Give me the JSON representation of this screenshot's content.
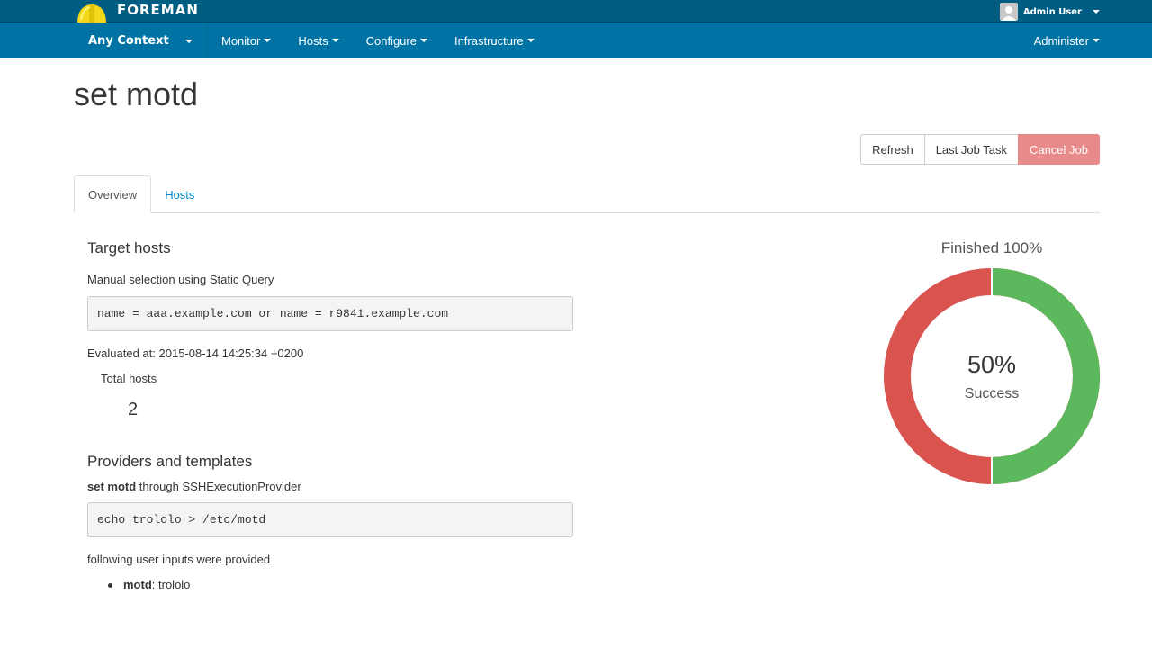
{
  "app": {
    "brand": "FOREMAN",
    "user": "Admin User"
  },
  "nav": {
    "context": "Any Context",
    "items": [
      {
        "label": "Monitor"
      },
      {
        "label": "Hosts"
      },
      {
        "label": "Configure"
      },
      {
        "label": "Infrastructure"
      }
    ],
    "right": "Administer"
  },
  "page": {
    "title": "set motd"
  },
  "actions": {
    "refresh": "Refresh",
    "last_job_task": "Last Job Task",
    "cancel_job": "Cancel Job"
  },
  "tabs": [
    {
      "label": "Overview",
      "active": true
    },
    {
      "label": "Hosts",
      "active": false
    }
  ],
  "target_hosts": {
    "heading": "Target hosts",
    "selection": "Manual selection using Static Query",
    "query": "name = aaa.example.com or name = r9841.example.com",
    "evaluated_at": "Evaluated at: 2015-08-14 14:25:34 +0200",
    "total_label": "Total hosts",
    "total_value": "2"
  },
  "providers": {
    "heading": "Providers and templates",
    "template_name": "set motd",
    "through_text": " through SSHExecutionProvider",
    "command": "echo trololo > /etc/motd",
    "inputs_text": "following user inputs were provided",
    "inputs": [
      {
        "name": "motd",
        "value": ": trololo"
      }
    ]
  },
  "status": {
    "title": "Finished 100%",
    "percent_label": "50%",
    "label": "Success",
    "success_fraction": 0.5,
    "colors": {
      "success": "#5cb85c",
      "failed": "#d9534f"
    }
  }
}
